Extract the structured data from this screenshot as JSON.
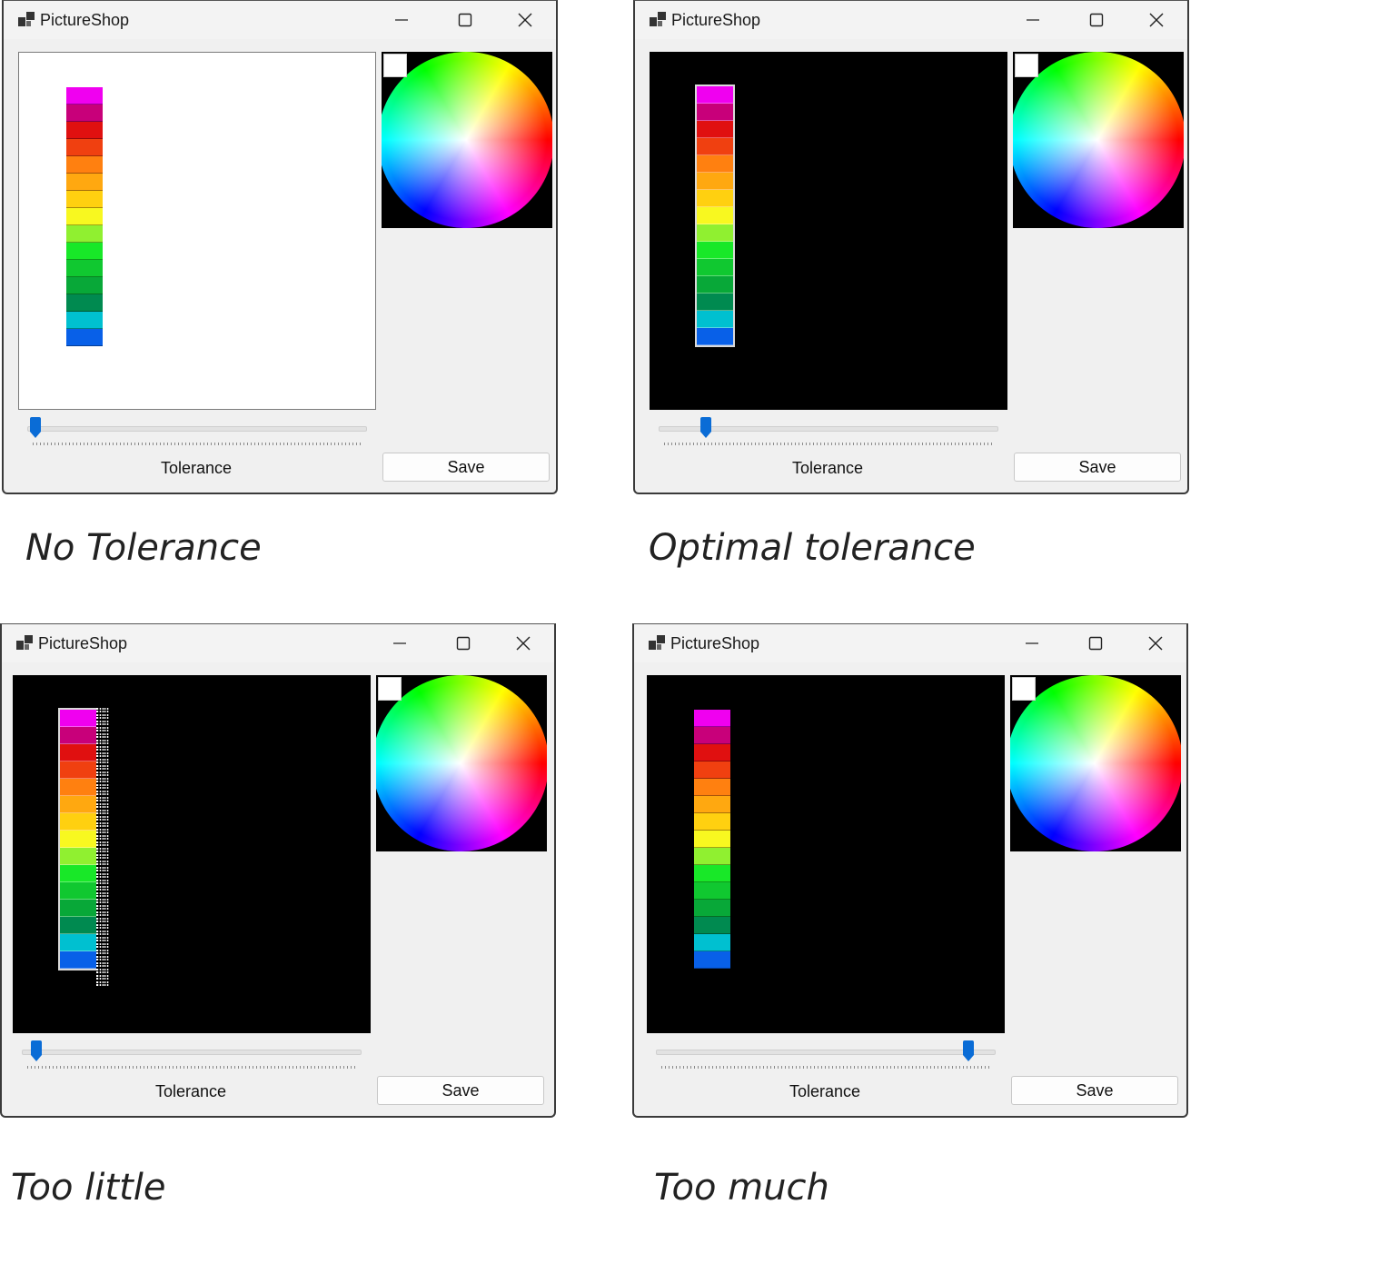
{
  "app_title": "PictureShop",
  "tolerance_label": "Tolerance",
  "save_label": "Save",
  "strip_colors": [
    "#f000f0",
    "#c8007a",
    "#e01010",
    "#f04010",
    "#ff8010",
    "#ffa810",
    "#ffd010",
    "#f8f820",
    "#90f030",
    "#18e828",
    "#10c830",
    "#08a838",
    "#008a50",
    "#00c0d0",
    "#0860e8"
  ],
  "panels": [
    {
      "caption": "No Tolerance",
      "canvas": "white",
      "slider_fraction": 0.0
    },
    {
      "caption": "Optimal tolerance",
      "canvas": "black",
      "slider_fraction": 0.12
    },
    {
      "caption": "Too little",
      "canvas": "black",
      "slider_fraction": 0.02
    },
    {
      "caption": "Too much",
      "canvas": "black",
      "slider_fraction": 0.94
    }
  ]
}
